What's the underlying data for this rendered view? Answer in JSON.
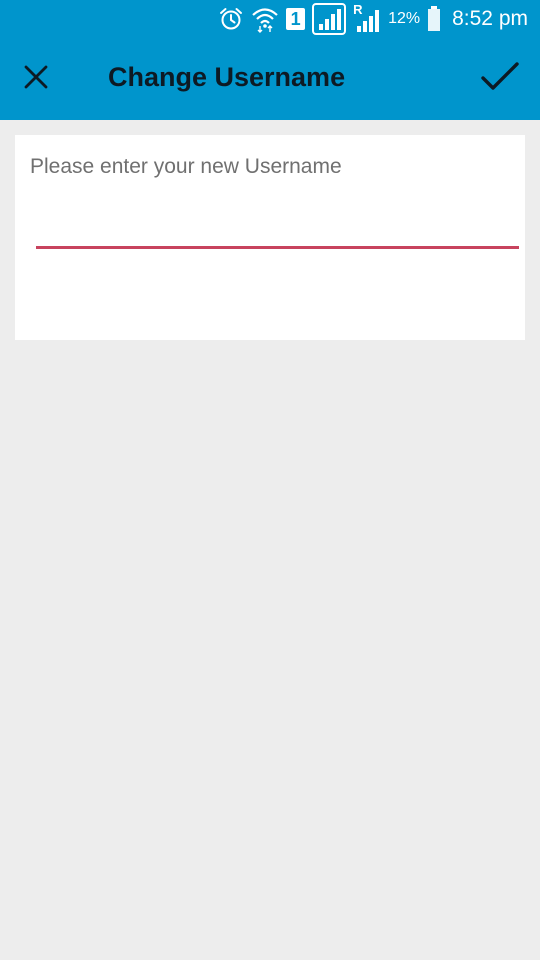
{
  "status_bar": {
    "sim_slot": "1",
    "roaming_indicator": "R",
    "battery_percent": "12%",
    "time": "8:52 pm",
    "icons": [
      "alarm-icon",
      "wifi-icon",
      "sim-1-icon",
      "signal-icon",
      "roaming-signal-icon",
      "battery-icon"
    ]
  },
  "toolbar": {
    "title": "Change Username",
    "close_icon": "close-icon",
    "confirm_icon": "checkmark-icon"
  },
  "form": {
    "prompt": "Please enter your new Username",
    "username_value": ""
  },
  "colors": {
    "app_bar": "#0095cc",
    "background": "#ededed",
    "card": "#ffffff",
    "input_underline": "#c8435e",
    "title_text": "#0d1a24",
    "prompt_text": "#707070"
  }
}
